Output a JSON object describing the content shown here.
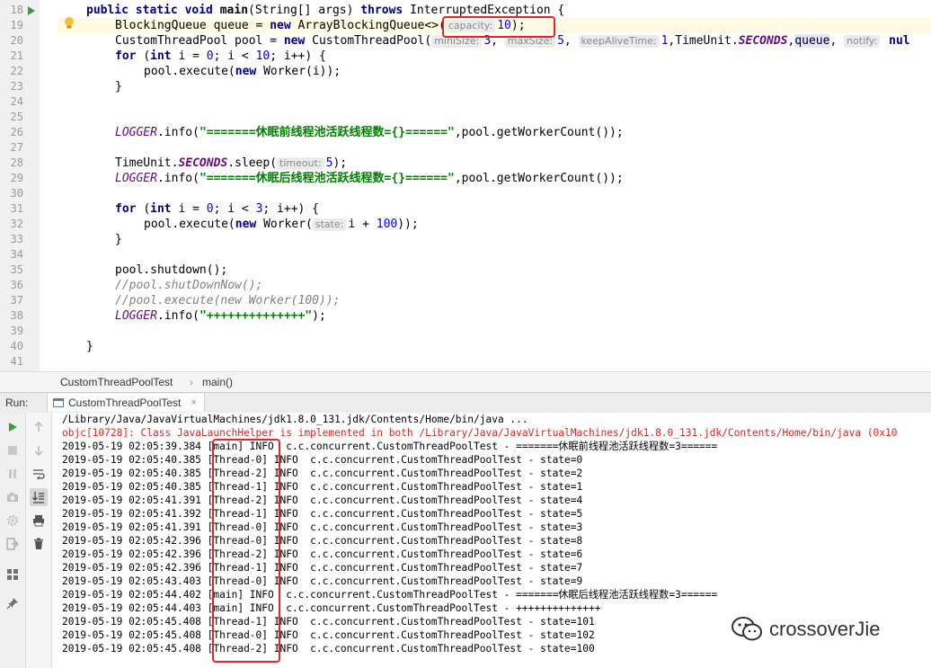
{
  "editor": {
    "line_numbers": [
      "18",
      "19",
      "20",
      "21",
      "22",
      "23",
      "24",
      "25",
      "26",
      "27",
      "28",
      "29",
      "30",
      "31",
      "32",
      "33",
      "34",
      "35",
      "36",
      "37",
      "38",
      "39",
      "40",
      "41"
    ],
    "lines": {
      "l18": {
        "kw1": "public static void ",
        "fn": "main",
        "rest": "(String[] args) ",
        "kw2": "throws ",
        "exc": "InterruptedException {"
      },
      "l19": {
        "a": "BlockingQueue queue = ",
        "kw": "new ",
        "b": "ArrayBlockingQueue<>(",
        "hint": "capacity:",
        "num": "10",
        "c": ");"
      },
      "l20": {
        "a": "CustomThreadPool pool = ",
        "kw": "new ",
        "b": "CustomThreadPool(",
        "hint1": "miniSize:",
        "n1": "3",
        "s1": ", ",
        "hint2": "maxSize:",
        "n2": "5",
        "s2": ", ",
        "hint3": "keepAliveTime:",
        "n3": "1",
        "s3": ",TimeUnit.",
        "it": "SECONDS",
        "s4": ",",
        "q": "queue",
        "s5": ", ",
        "hint4": "notify:",
        "tail": " nul"
      },
      "l21": {
        "kw1": "for ",
        "a": "(",
        "kw2": "int ",
        "b": "i = ",
        "n1": "0",
        "c": "; i < ",
        "n2": "10",
        "d": "; i++) {"
      },
      "l22": {
        "a": "pool.execute(",
        "kw": "new ",
        "b": "Worker(i));"
      },
      "l23": {
        "a": "}"
      },
      "l26": {
        "it": "LOGGER",
        "a": ".info(",
        "str": "\"=======休眠前线程池活跃线程数={}======\"",
        "b": ",pool.getWorkerCount());"
      },
      "l28": {
        "a": "TimeUnit.",
        "it": "SECONDS",
        "b": ".sleep(",
        "hint": "timeout:",
        "num": "5",
        "c": ");"
      },
      "l29": {
        "it": "LOGGER",
        "a": ".info(",
        "str": "\"=======休眠后线程池活跃线程数={}======\"",
        "b": ",pool.getWorkerCount());"
      },
      "l31": {
        "kw1": "for ",
        "a": "(",
        "kw2": "int ",
        "b": "i = ",
        "n1": "0",
        "c": "; i < ",
        "n2": "3",
        "d": "; i++) {"
      },
      "l32": {
        "a": "pool.execute(",
        "kw": "new ",
        "b": "Worker(",
        "hint": "state:",
        "c": "i + ",
        "num": "100",
        "d": "));"
      },
      "l33": {
        "a": "}"
      },
      "l35": {
        "a": "pool.shutdown();"
      },
      "l36": {
        "a": "//pool.shutDownNow();"
      },
      "l37": {
        "a": "//pool.execute(new Worker(100));"
      },
      "l38": {
        "it": "LOGGER",
        "a": ".info(",
        "str": "\"++++++++++++++\"",
        "b": ");"
      },
      "l40": {
        "a": "}"
      }
    }
  },
  "breadcrumb": {
    "class_name": "CustomThreadPoolTest",
    "method_name": "main()"
  },
  "run": {
    "label": "Run:",
    "tab_label": "CustomThreadPoolTest",
    "tab_close": "×",
    "output": [
      "/Library/Java/JavaVirtualMachines/jdk1.8.0_131.jdk/Contents/Home/bin/java ...",
      "objc[10728]: Class JavaLaunchHelper is implemented in both /Library/Java/JavaVirtualMachines/jdk1.8.0_131.jdk/Contents/Home/bin/java (0x10",
      "2019-05-19 02:05:39.384 [main] INFO  c.c.concurrent.CustomThreadPoolTest - =======休眠前线程池活跃线程数=3======",
      "2019-05-19 02:05:40.385 [Thread-0] INFO  c.c.concurrent.CustomThreadPoolTest - state=0",
      "2019-05-19 02:05:40.385 [Thread-2] INFO  c.c.concurrent.CustomThreadPoolTest - state=2",
      "2019-05-19 02:05:40.385 [Thread-1] INFO  c.c.concurrent.CustomThreadPoolTest - state=1",
      "2019-05-19 02:05:41.391 [Thread-2] INFO  c.c.concurrent.CustomThreadPoolTest - state=4",
      "2019-05-19 02:05:41.392 [Thread-1] INFO  c.c.concurrent.CustomThreadPoolTest - state=5",
      "2019-05-19 02:05:41.391 [Thread-0] INFO  c.c.concurrent.CustomThreadPoolTest - state=3",
      "2019-05-19 02:05:42.396 [Thread-0] INFO  c.c.concurrent.CustomThreadPoolTest - state=8",
      "2019-05-19 02:05:42.396 [Thread-2] INFO  c.c.concurrent.CustomThreadPoolTest - state=6",
      "2019-05-19 02:05:42.396 [Thread-1] INFO  c.c.concurrent.CustomThreadPoolTest - state=7",
      "2019-05-19 02:05:43.403 [Thread-0] INFO  c.c.concurrent.CustomThreadPoolTest - state=9",
      "2019-05-19 02:05:44.402 [main] INFO  c.c.concurrent.CustomThreadPoolTest - =======休眠后线程池活跃线程数=3======",
      "2019-05-19 02:05:44.403 [main] INFO  c.c.concurrent.CustomThreadPoolTest - ++++++++++++++",
      "2019-05-19 02:05:45.408 [Thread-1] INFO  c.c.concurrent.CustomThreadPoolTest - state=101",
      "2019-05-19 02:05:45.408 [Thread-0] INFO  c.c.concurrent.CustomThreadPoolTest - state=102",
      "2019-05-19 02:05:45.408 [Thread-2] INFO  c.c.concurrent.CustomThreadPoolTest - state=100"
    ]
  },
  "watermark": {
    "text": "crossoverJie"
  },
  "colors": {
    "highlight_box": "#e0262b",
    "error_text": "#d02b25",
    "string": "#008000",
    "keyword": "#000080"
  }
}
